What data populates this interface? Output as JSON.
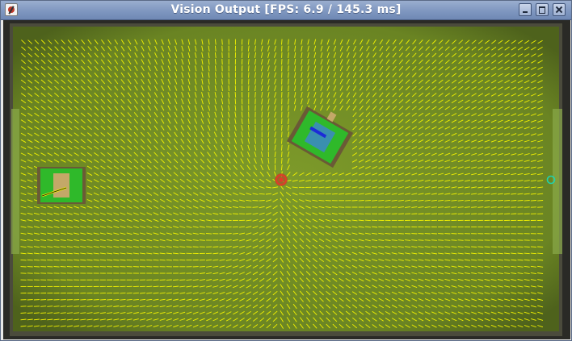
{
  "window": {
    "title": "Vision Output [FPS: 6.9 / 145.3 ms]",
    "icon": "app-icon",
    "controls": [
      "minimize-icon",
      "maximize-icon",
      "close-icon"
    ]
  },
  "scene": {
    "field_color": "#6f8a24",
    "vector_color": "#f2f200",
    "robot_color": "#2fb92a",
    "ball_marker_color": "#e23a2a",
    "target_marker_color": "#1fd3b0"
  }
}
